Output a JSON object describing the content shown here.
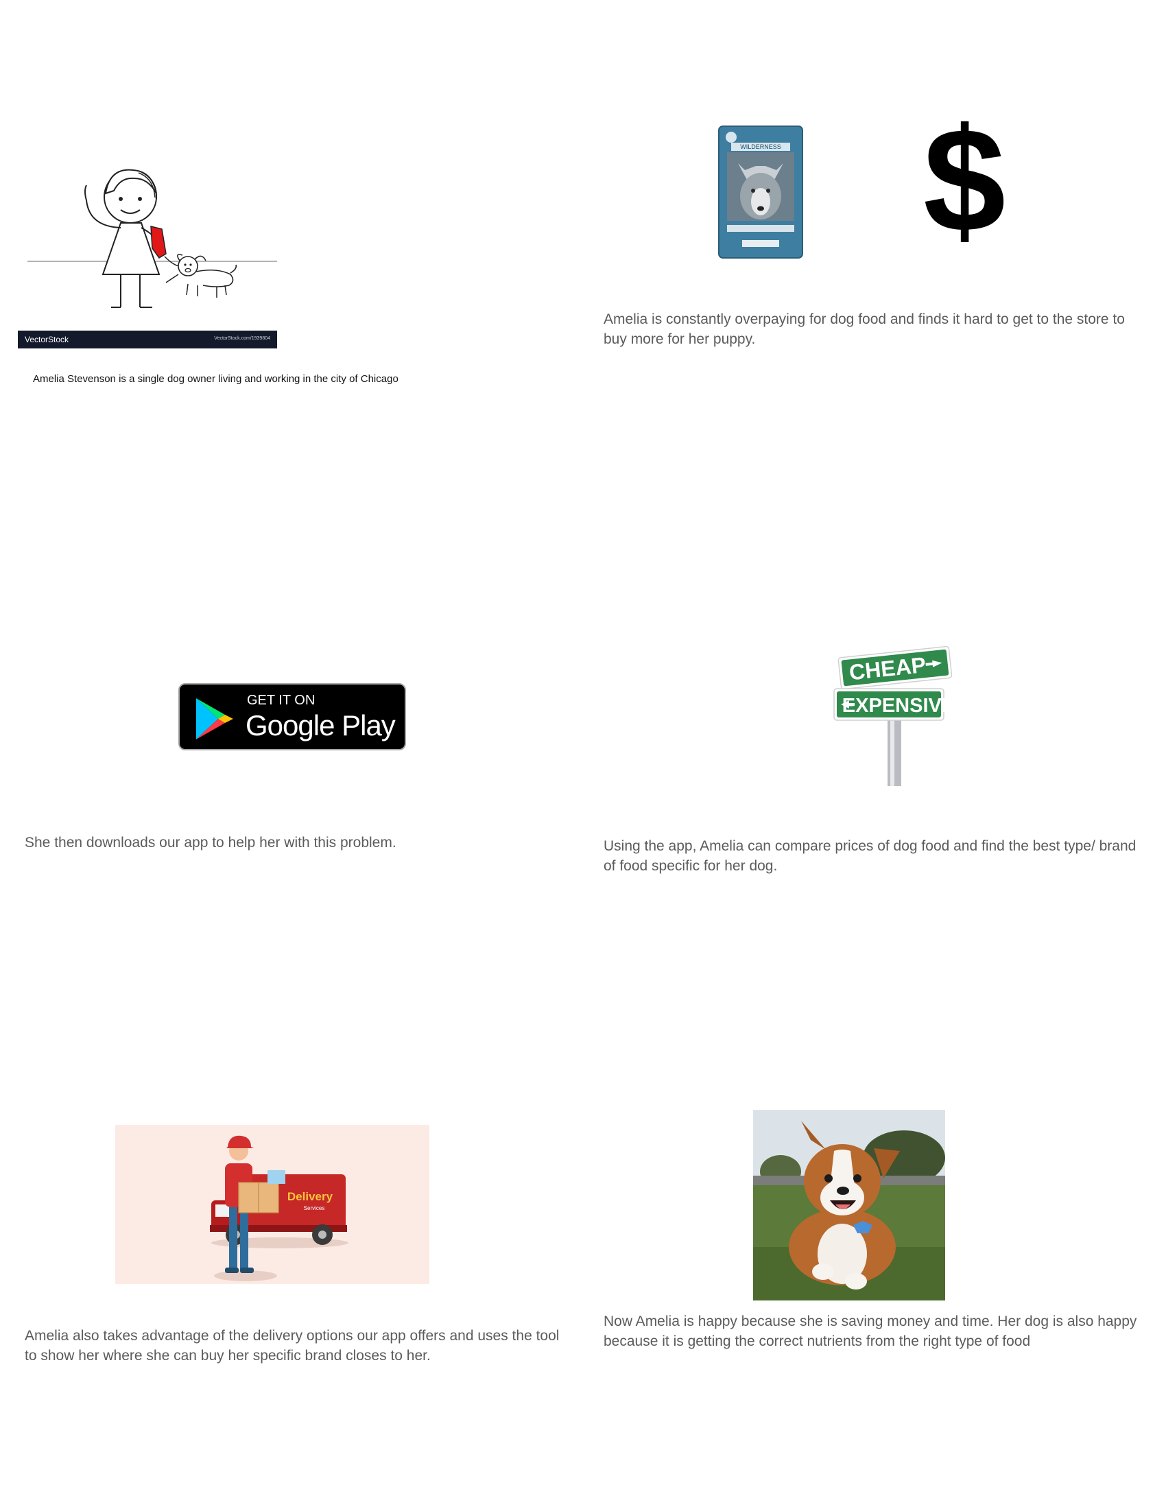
{
  "panel1": {
    "watermark_brand": "VectorStock",
    "watermark_url": "VectorStock.com/1939804",
    "caption": "Amelia Stevenson is a single dog owner living and working in the city of Chicago"
  },
  "panel2": {
    "bag_brand": "WILDERNESS",
    "dollar_symbol": "$",
    "caption": "Amelia is constantly overpaying for dog food and finds it hard to get to the store to buy more for her puppy."
  },
  "panel3": {
    "badge_top": "GET IT ON",
    "badge_bottom": "Google Play",
    "caption": "She then downloads our app to help her with this problem."
  },
  "panel4": {
    "sign_top": "CHEAP",
    "sign_bottom": "EXPENSIVE",
    "caption": "Using the app, Amelia can compare prices of dog food and find the best type/ brand of food specific for her dog."
  },
  "panel5": {
    "truck_label": "Delivery",
    "truck_sublabel": "Services",
    "caption": "Amelia also takes advantage of the delivery options our app offers and uses the tool to show her where she can buy her specific brand closes to her."
  },
  "panel6": {
    "caption": "Now Amelia is happy because she is saving money and time. Her dog is also happy because it is getting the correct nutrients from the right type of food"
  }
}
